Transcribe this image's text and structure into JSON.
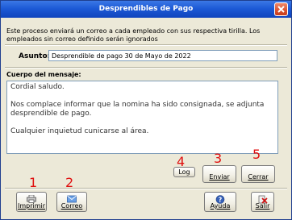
{
  "window": {
    "title": "Desprendibles de Pago"
  },
  "description": "Este proceso enviará un correo a cada empleado con sus respectiva tirilla. Los empleados sin correo definido serán ignorados",
  "subject": {
    "label": "Asunto:",
    "value": "Desprendible de pago 30 de Mayo de 2022"
  },
  "body": {
    "label": "Cuerpo del mensaje:",
    "lines": [
      "Cordial saludo.",
      "Nos complace informar que la nomina ha sido consignada, se adjunta desprendible de pago.",
      "Cualquier inquietud cunicarse al área."
    ]
  },
  "buttons": {
    "log": "Log",
    "enviar": "Enviar",
    "cerrar": "Cerrar",
    "imprimir": "Imprimir",
    "correo": "Correo",
    "ayuda": "Ayuda",
    "salir": "Salir"
  },
  "annotations": [
    "1",
    "2",
    "3",
    "4",
    "5"
  ],
  "colors": {
    "annotation": "#e01010",
    "titlebar": "#0f44bd"
  },
  "icons": {
    "imprimir": "printer-icon",
    "correo": "mail-icon",
    "ayuda": "help-icon",
    "salir": "exit-icon",
    "close": "close-icon"
  }
}
